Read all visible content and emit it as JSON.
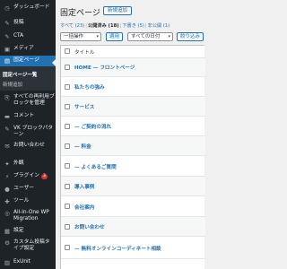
{
  "sidebar": {
    "items": [
      {
        "label": "ダッシュボード",
        "icon": "dashboard-icon",
        "glyph": "◷"
      },
      {
        "label": "投稿",
        "icon": "pin-icon",
        "glyph": "✎"
      },
      {
        "label": "CTA",
        "icon": "cta-icon",
        "glyph": "✎"
      },
      {
        "label": "メディア",
        "icon": "media-icon",
        "glyph": "▣"
      },
      {
        "label": "固定ページ",
        "icon": "pages-icon",
        "glyph": "▤"
      },
      {
        "label": "すべての再利用ブロックを管理",
        "icon": "blocks-icon",
        "glyph": "⎘"
      },
      {
        "label": "コメント",
        "icon": "comment-icon",
        "glyph": "▬"
      },
      {
        "label": "VK ブロックパターン",
        "icon": "pattern-icon",
        "glyph": "✎"
      },
      {
        "label": "お問い合わせ",
        "icon": "mail-icon",
        "glyph": "✉"
      },
      {
        "label": "外観",
        "icon": "appearance-icon",
        "glyph": "✦"
      },
      {
        "label": "プラグイン",
        "icon": "plugin-icon",
        "glyph": "⚡"
      },
      {
        "label": "ユーザー",
        "icon": "user-icon",
        "glyph": "●"
      },
      {
        "label": "ツール",
        "icon": "tools-icon",
        "glyph": "✚"
      },
      {
        "label": "All-in-One WP Migration",
        "icon": "migration-icon",
        "glyph": "◎"
      },
      {
        "label": "設定",
        "icon": "settings-icon",
        "glyph": "▦"
      },
      {
        "label": "カスタム投稿タイプ設定",
        "icon": "custom-post-icon",
        "glyph": "⚙"
      },
      {
        "label": "ExUnit",
        "icon": "exunit-icon",
        "glyph": "▨"
      }
    ],
    "plugin_badge": "3",
    "submenu": {
      "all_pages": "固定ページ一覧",
      "add_new": "新規追加"
    }
  },
  "header": {
    "title": "固定ページ",
    "add_new": "新規追加"
  },
  "views": {
    "all": "すべて (23)",
    "published": "公開済み (18)",
    "drafts": "下書き (5)",
    "private": "非公開 (1)"
  },
  "toolbar": {
    "bulk_action": "一括操作",
    "apply": "適用",
    "date_filter": "すべての日付",
    "filter": "絞り込み"
  },
  "table": {
    "column_title": "タイトル",
    "rows": [
      "HOME — フロントページ",
      "私たちの強み",
      "サービス",
      "— ご契約の流れ",
      "— 料金",
      "— よくあるご質問",
      "導入事例",
      "会社案内",
      "お問い合わせ",
      "— 無料オンラインコーディネート相談"
    ]
  }
}
